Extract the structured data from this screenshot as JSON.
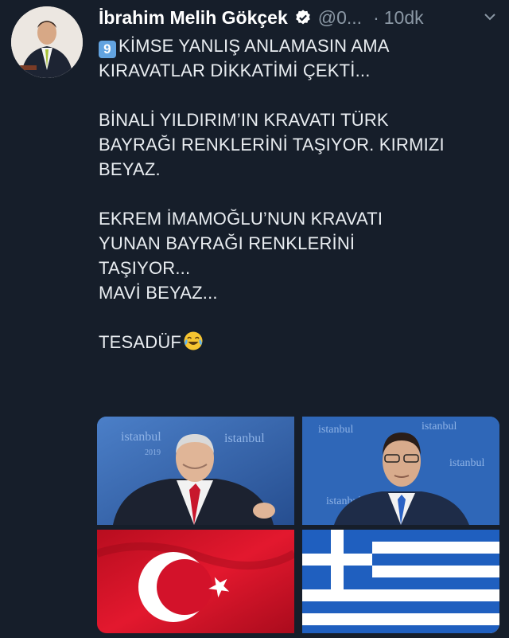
{
  "tweet": {
    "author_name": "İbrahim Melih Gökçek",
    "handle": "@0...",
    "separator": "·",
    "time": "10dk",
    "verified_icon": "verified-badge-icon",
    "caret_icon": "chevron-down-icon",
    "lines": [
      "KİMSE YANLIŞ ANLAMASIN AMA",
      "KIRAVATLAR DİKKATİMİ ÇEKTİ...",
      "",
      "BİNALİ YILDIRIM’IN KRAVATI TÜRK",
      "BAYRAĞI RENKLERİNİ TAŞIYOR. KIRMIZI",
      "BEYAZ.",
      "",
      "EKREM İMAMOĞLU’NUN KRAVATI",
      "YUNAN BAYRAĞI RENKLERİNİ",
      "TAŞIYOR...",
      "MAVİ BEYAZ...",
      "",
      "TESADÜF"
    ],
    "keycap_emoji": "9",
    "media": {
      "watermark": "istanbul",
      "watermark_year": "2019"
    }
  },
  "colors": {
    "background": "#161e2a",
    "text": "#e9edf1",
    "muted": "#8b98a5",
    "turkey_red": "#d3122a",
    "greece_blue": "#1f5fbf"
  }
}
